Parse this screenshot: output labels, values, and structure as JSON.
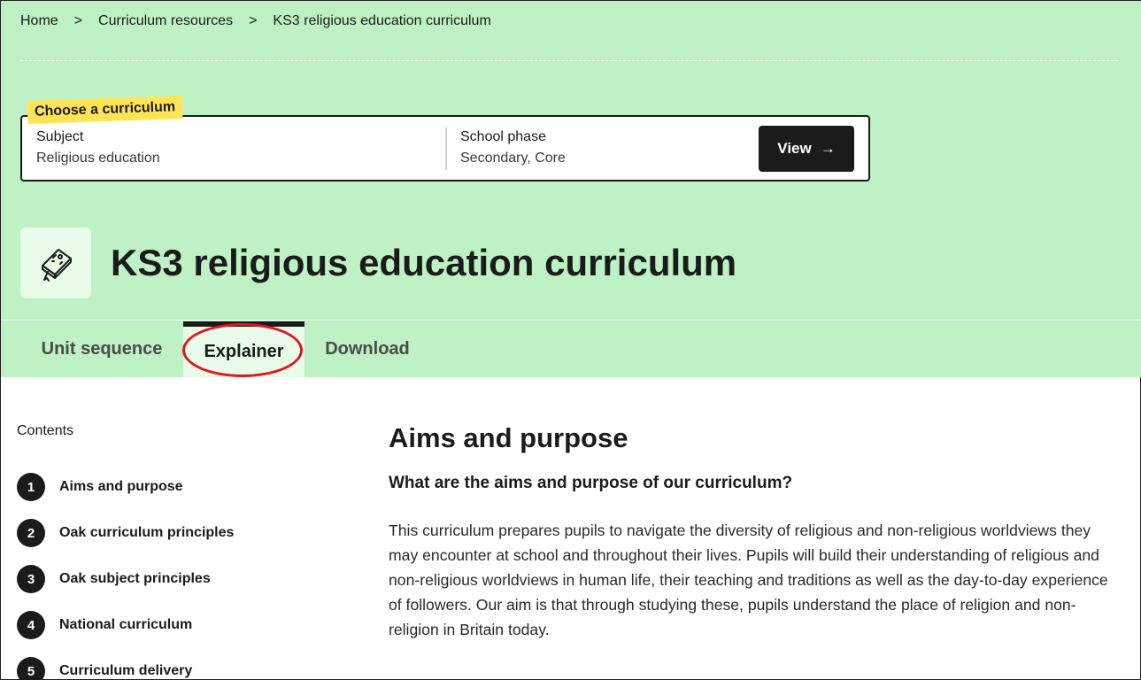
{
  "breadcrumb": {
    "items": [
      "Home",
      "Curriculum resources",
      "KS3 religious education curriculum"
    ],
    "separator": ">"
  },
  "chooser": {
    "label": "Choose a curriculum",
    "subject_label": "Subject",
    "subject_value": "Religious education",
    "phase_label": "School phase",
    "phase_value": "Secondary, Core",
    "view_label": "View",
    "view_arrow": "→"
  },
  "header": {
    "icon": "religious-book-icon",
    "title": "KS3 religious education curriculum"
  },
  "tabs": [
    {
      "label": "Unit sequence",
      "active": false
    },
    {
      "label": "Explainer",
      "active": true
    },
    {
      "label": "Download",
      "active": false
    }
  ],
  "sidebar": {
    "title": "Contents",
    "items": [
      {
        "num": "1",
        "label": "Aims and purpose"
      },
      {
        "num": "2",
        "label": "Oak curriculum principles"
      },
      {
        "num": "3",
        "label": "Oak subject principles"
      },
      {
        "num": "4",
        "label": "National curriculum"
      },
      {
        "num": "5",
        "label": "Curriculum delivery"
      }
    ]
  },
  "main": {
    "heading": "Aims and purpose",
    "subheading": "What are the aims and purpose of our curriculum?",
    "paragraph": "This curriculum prepares pupils to navigate the diversity of religious and non-religious worldviews they may encounter at school and throughout their lives. Pupils will build their understanding of religious and non-religious worldviews in human life, their teaching and traditions as well as the day-to-day experience of followers. Our aim is that through studying these, pupils understand the place of religion and non-religion in Britain today."
  },
  "colors": {
    "hero_bg": "#bef2c4",
    "active_tab_bg": "#e9fbe9",
    "label_yellow": "#ffe555",
    "annotation_red": "#e0171f",
    "dark": "#1b1b1b"
  }
}
